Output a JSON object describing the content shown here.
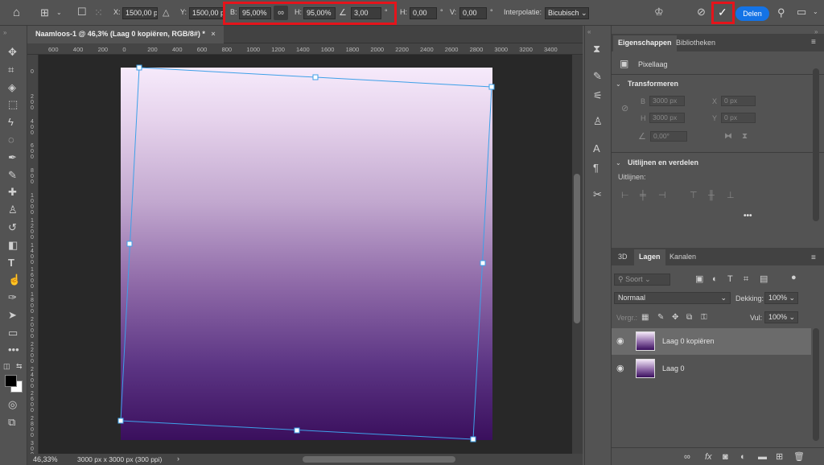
{
  "options_bar": {
    "x_label": "X:",
    "x_value": "1500,00 p",
    "y_label": "Y:",
    "y_value": "1500,00 p",
    "w_label": "B:",
    "w_value": "95,00%",
    "h_label": "H:",
    "h_value": "95,00%",
    "angle_value": "3,00",
    "angle_unit": "°",
    "hskew_label": "H:",
    "hskew_value": "0,00",
    "hskew_unit": "°",
    "vskew_label": "V:",
    "vskew_value": "0,00",
    "vskew_unit": "°",
    "interp_label": "Interpolatie:",
    "interp_value": "Bicubisch",
    "share_label": "Delen",
    "highlight_color": "#e5141b",
    "accent_color": "#1473e6"
  },
  "document": {
    "tab_title": "Naamloos-1 @ 46,3% (Laag 0 kopiëren, RGB/8#) *",
    "close": "×"
  },
  "ruler": {
    "h_ticks": [
      "600",
      "400",
      "200",
      "0",
      "200",
      "400",
      "600",
      "800",
      "1000",
      "1200",
      "1400",
      "1600",
      "1800",
      "2000",
      "2200",
      "2400",
      "2600",
      "2800",
      "3000",
      "3200",
      "3400"
    ],
    "v_ticks": [
      "0",
      "200",
      "400",
      "600",
      "800",
      "1000",
      "1200",
      "1400",
      "1600",
      "1800",
      "2000",
      "2200",
      "2400",
      "2600",
      "2800",
      "3000"
    ]
  },
  "status": {
    "zoom": "46,33%",
    "doc_size": "3000 px x 3000 px (300 ppi)"
  },
  "properties_panel": {
    "tabs": [
      "Eigenschappen",
      "Bibliotheken"
    ],
    "layer_type": "Pixellaag",
    "transform_title": "Transformeren",
    "w_label": "B",
    "w_value": "3000 px",
    "h_label": "H",
    "h_value": "3000 px",
    "x_label": "X",
    "x_value": "0 px",
    "y_label": "Y",
    "y_value": "0 px",
    "angle_value": "0,00°",
    "align_title": "Uitlijnen en verdelen",
    "align_sub": "Uitlijnen:",
    "more": "•••"
  },
  "layers_panel": {
    "tabs": [
      "3D",
      "Lagen",
      "Kanalen"
    ],
    "search_placeholder": "Soort",
    "blend_mode": "Normaal",
    "opacity_label": "Dekking:",
    "opacity_value": "100%",
    "lock_label": "Vergr.:",
    "fill_label": "Vul:",
    "fill_value": "100%",
    "layers": [
      {
        "name": "Laag 0 kopiëren",
        "selected": true
      },
      {
        "name": "Laag 0",
        "selected": false
      }
    ]
  }
}
